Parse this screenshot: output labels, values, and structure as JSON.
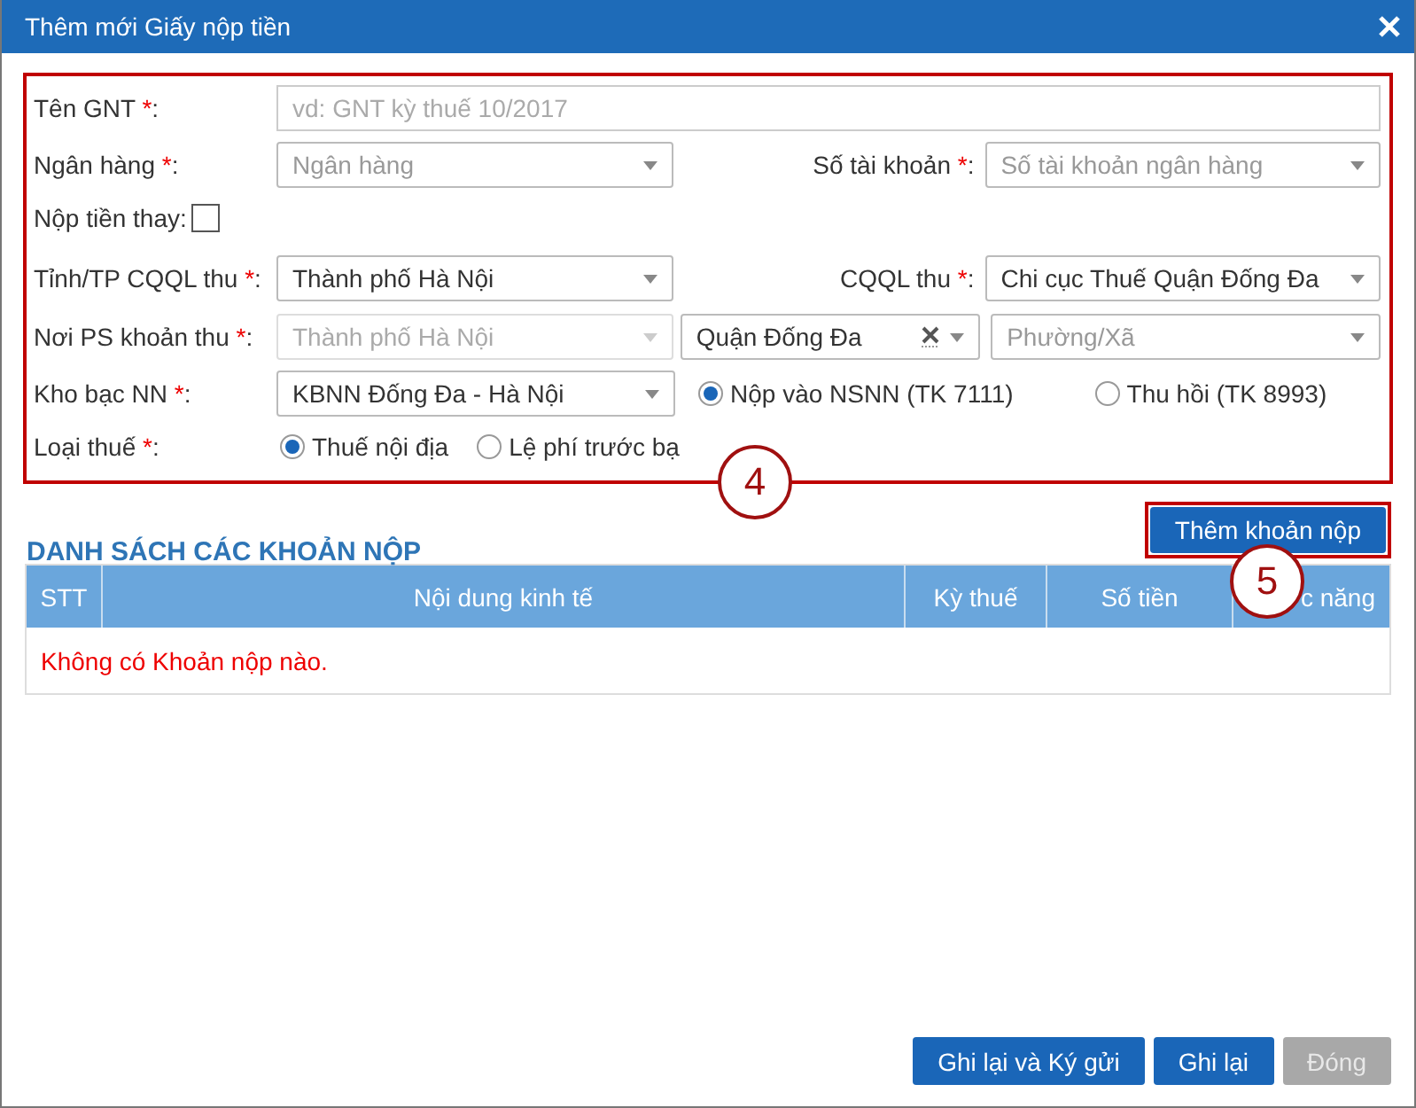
{
  "window": {
    "title": "Thêm mới Giấy nộp tiền"
  },
  "form": {
    "ten_gnt": {
      "label": "Tên GNT ",
      "mark": "*",
      "end": ":",
      "placeholder": "vd: GNT kỳ thuế 10/2017"
    },
    "ngan_hang": {
      "label": "Ngân hàng ",
      "mark": "*",
      "end": ":",
      "placeholder": "Ngân hàng"
    },
    "so_tai_khoan": {
      "label": "Số tài khoản ",
      "mark": "*",
      "end": ":",
      "placeholder": "Số tài khoản ngân hàng"
    },
    "nop_tien_thay": {
      "label": "Nộp tiền thay:",
      "checked": false
    },
    "tinh_tp": {
      "label": "Tỉnh/TP CQQL thu ",
      "mark": "*",
      "end": ":",
      "value": "Thành phố Hà Nội"
    },
    "cqql_thu": {
      "label": "CQQL thu ",
      "mark": "*",
      "end": ":",
      "value": "Chi cục Thuế Quận Đống Đa"
    },
    "noi_ps": {
      "label": "Nơi PS khoản thu ",
      "mark": "*",
      "end": ":",
      "selects": [
        {
          "value": "Thành phố Hà Nội",
          "disabled": true,
          "clearable": false
        },
        {
          "value": "Quận Đống Đa",
          "disabled": false,
          "clearable": true
        },
        {
          "placeholder": "Phường/Xã",
          "disabled": false,
          "clearable": false
        }
      ]
    },
    "kho_bac": {
      "label": "Kho bạc NN ",
      "mark": "*",
      "end": ":",
      "value": "KBNN Đống Đa - Hà Nội",
      "options": [
        {
          "label": "Nộp vào NSNN (TK 7111)",
          "selected": true
        },
        {
          "label": "Thu hồi (TK 8993)",
          "selected": false
        }
      ]
    },
    "loai_thue": {
      "label": "Loại thuế ",
      "mark": "*",
      "end": ":",
      "options": [
        {
          "label": "Thuế nội địa",
          "selected": true
        },
        {
          "label": "Lệ phí trước bạ",
          "selected": false
        }
      ]
    }
  },
  "callouts": [
    "4",
    "5"
  ],
  "section_title": "DANH SÁCH CÁC KHOẢN NỘP",
  "add_button": "Thêm khoản nộp",
  "table": {
    "columns": [
      "STT",
      "Nội dung kinh tế",
      "Kỳ thuế",
      "Số tiền",
      "c năng"
    ],
    "empty_message": "Không có Khoản nộp nào."
  },
  "buttons": [
    {
      "label": "Ghi lại và Ký gửi",
      "disabled": false
    },
    {
      "label": "Ghi lại",
      "disabled": false
    },
    {
      "label": "Đóng",
      "disabled": true
    }
  ]
}
